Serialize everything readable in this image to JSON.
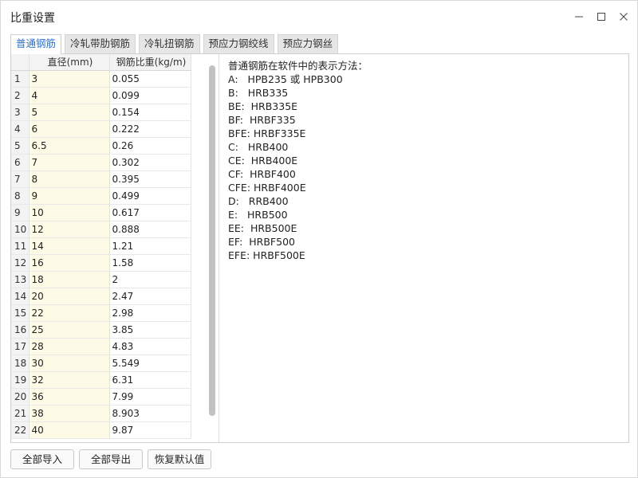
{
  "window": {
    "title": "比重设置"
  },
  "tabs": [
    {
      "label": "普通钢筋",
      "active": true
    },
    {
      "label": "冷轧带肋钢筋",
      "active": false
    },
    {
      "label": "冷轧扭钢筋",
      "active": false
    },
    {
      "label": "预应力钢绞线",
      "active": false
    },
    {
      "label": "预应力钢丝",
      "active": false
    }
  ],
  "table": {
    "headers": {
      "diameter": "直径(mm)",
      "weight": "钢筋比重(kg/m)"
    },
    "rows": [
      {
        "num": "1",
        "diameter": "3",
        "weight": "0.055"
      },
      {
        "num": "2",
        "diameter": "4",
        "weight": "0.099"
      },
      {
        "num": "3",
        "diameter": "5",
        "weight": "0.154"
      },
      {
        "num": "4",
        "diameter": "6",
        "weight": "0.222"
      },
      {
        "num": "5",
        "diameter": "6.5",
        "weight": "0.26"
      },
      {
        "num": "6",
        "diameter": "7",
        "weight": "0.302"
      },
      {
        "num": "7",
        "diameter": "8",
        "weight": "0.395"
      },
      {
        "num": "8",
        "diameter": "9",
        "weight": "0.499"
      },
      {
        "num": "9",
        "diameter": "10",
        "weight": "0.617"
      },
      {
        "num": "10",
        "diameter": "12",
        "weight": "0.888"
      },
      {
        "num": "11",
        "diameter": "14",
        "weight": "1.21"
      },
      {
        "num": "12",
        "diameter": "16",
        "weight": "1.58"
      },
      {
        "num": "13",
        "diameter": "18",
        "weight": "2"
      },
      {
        "num": "14",
        "diameter": "20",
        "weight": "2.47"
      },
      {
        "num": "15",
        "diameter": "22",
        "weight": "2.98"
      },
      {
        "num": "16",
        "diameter": "25",
        "weight": "3.85"
      },
      {
        "num": "17",
        "diameter": "28",
        "weight": "4.83"
      },
      {
        "num": "18",
        "diameter": "30",
        "weight": "5.549"
      },
      {
        "num": "19",
        "diameter": "32",
        "weight": "6.31"
      },
      {
        "num": "20",
        "diameter": "36",
        "weight": "7.99"
      },
      {
        "num": "21",
        "diameter": "38",
        "weight": "8.903"
      },
      {
        "num": "22",
        "diameter": "40",
        "weight": "9.87"
      }
    ]
  },
  "info": {
    "heading": "普通钢筋在软件中的表示方法：",
    "lines": [
      "A:   HPB235 或 HPB300",
      "B:   HRB335",
      "BE:  HRB335E",
      "BF:  HRBF335",
      "BFE: HRBF335E",
      "C:   HRB400",
      "CE:  HRB400E",
      "CF:  HRBF400",
      "CFE: HRBF400E",
      "D:   RRB400",
      "E:   HRB500",
      "EE:  HRB500E",
      "EF:  HRBF500",
      "EFE: HRBF500E"
    ]
  },
  "buttons": {
    "import_all": "全部导入",
    "export_all": "全部导出",
    "restore_default": "恢复默认值"
  },
  "colors": {
    "active_tab_text": "#2a72c8",
    "diameter_cell_bg": "#fdfbe6"
  },
  "icons": {
    "minimize": "minimize-icon",
    "maximize": "maximize-icon",
    "close": "close-icon"
  }
}
